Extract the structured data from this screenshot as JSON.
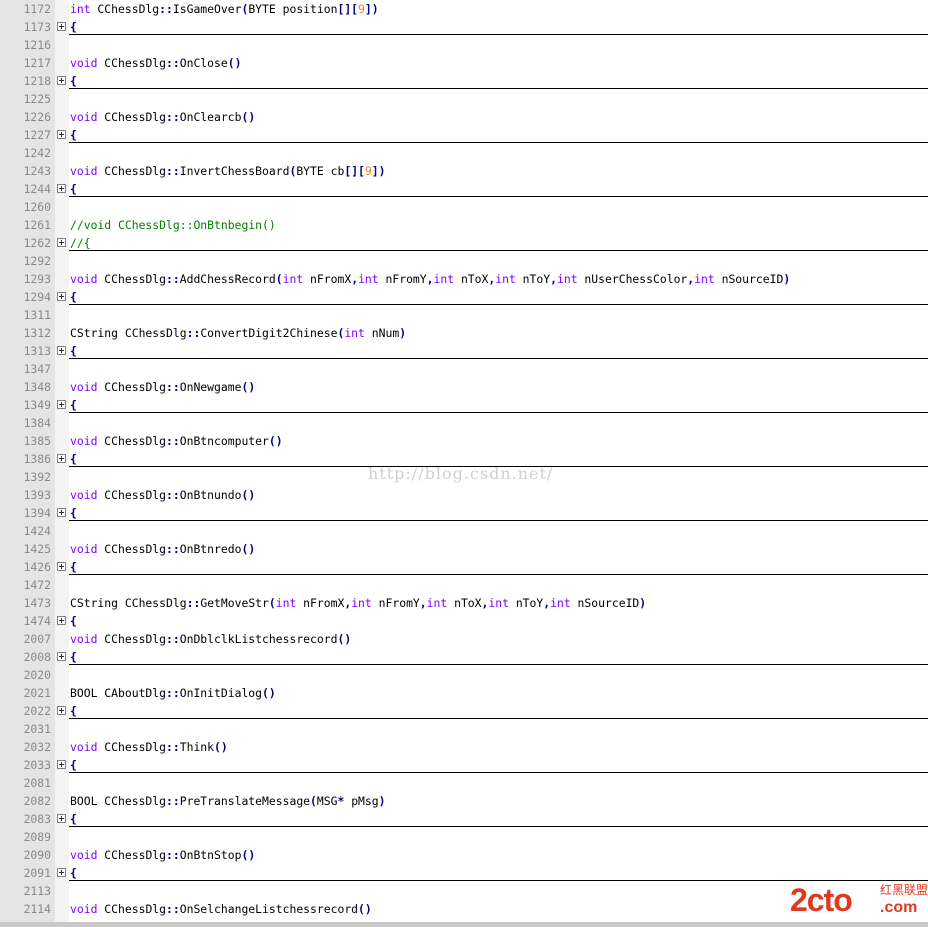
{
  "editor": {
    "rows": [
      {
        "ln": "1172",
        "code": [
          {
            "t": "int",
            "c": "kw"
          },
          {
            "t": " CChessDlg"
          },
          {
            "t": "::",
            "c": "op"
          },
          {
            "t": "IsGameOver"
          },
          {
            "t": "(",
            "c": "op"
          },
          {
            "t": "BYTE position"
          },
          {
            "t": "[][",
            "c": "op"
          },
          {
            "t": "9",
            "c": "num"
          },
          {
            "t": "])",
            "c": "op"
          }
        ]
      },
      {
        "ln": "1173",
        "fold": true,
        "line": true,
        "code": [
          {
            "t": "{",
            "c": "op"
          }
        ]
      },
      {
        "ln": "1216",
        "code": []
      },
      {
        "ln": "1217",
        "code": [
          {
            "t": "void",
            "c": "kw"
          },
          {
            "t": " CChessDlg"
          },
          {
            "t": "::",
            "c": "op"
          },
          {
            "t": "OnClose"
          },
          {
            "t": "()",
            "c": "op"
          }
        ]
      },
      {
        "ln": "1218",
        "fold": true,
        "line": true,
        "code": [
          {
            "t": "{",
            "c": "op"
          }
        ]
      },
      {
        "ln": "1225",
        "code": []
      },
      {
        "ln": "1226",
        "code": [
          {
            "t": "void",
            "c": "kw"
          },
          {
            "t": " CChessDlg"
          },
          {
            "t": "::",
            "c": "op"
          },
          {
            "t": "OnClearcb"
          },
          {
            "t": "()",
            "c": "op"
          }
        ]
      },
      {
        "ln": "1227",
        "fold": true,
        "line": true,
        "code": [
          {
            "t": "{",
            "c": "op"
          }
        ]
      },
      {
        "ln": "1242",
        "code": []
      },
      {
        "ln": "1243",
        "code": [
          {
            "t": "void",
            "c": "kw"
          },
          {
            "t": " CChessDlg"
          },
          {
            "t": "::",
            "c": "op"
          },
          {
            "t": "InvertChessBoard"
          },
          {
            "t": "(",
            "c": "op"
          },
          {
            "t": "BYTE cb"
          },
          {
            "t": "[][",
            "c": "op"
          },
          {
            "t": "9",
            "c": "num"
          },
          {
            "t": "])",
            "c": "op"
          }
        ]
      },
      {
        "ln": "1244",
        "fold": true,
        "line": true,
        "code": [
          {
            "t": "{",
            "c": "op"
          }
        ]
      },
      {
        "ln": "1260",
        "code": []
      },
      {
        "ln": "1261",
        "code": [
          {
            "t": "//void CChessDlg::OnBtnbegin()",
            "c": "cm"
          }
        ]
      },
      {
        "ln": "1262",
        "fold": true,
        "line": true,
        "code": [
          {
            "t": "//{",
            "c": "cm"
          }
        ]
      },
      {
        "ln": "1292",
        "code": []
      },
      {
        "ln": "1293",
        "code": [
          {
            "t": "void",
            "c": "kw"
          },
          {
            "t": " CChessDlg"
          },
          {
            "t": "::",
            "c": "op"
          },
          {
            "t": "AddChessRecord"
          },
          {
            "t": "(",
            "c": "op"
          },
          {
            "t": "int",
            "c": "kw"
          },
          {
            "t": " nFromX"
          },
          {
            "t": ",",
            "c": "op"
          },
          {
            "t": "int",
            "c": "kw"
          },
          {
            "t": " nFromY"
          },
          {
            "t": ",",
            "c": "op"
          },
          {
            "t": "int",
            "c": "kw"
          },
          {
            "t": " nToX"
          },
          {
            "t": ",",
            "c": "op"
          },
          {
            "t": "int",
            "c": "kw"
          },
          {
            "t": " nToY"
          },
          {
            "t": ",",
            "c": "op"
          },
          {
            "t": "int",
            "c": "kw"
          },
          {
            "t": " nUserChessColor"
          },
          {
            "t": ",",
            "c": "op"
          },
          {
            "t": "int",
            "c": "kw"
          },
          {
            "t": " nSourceID"
          },
          {
            "t": ")",
            "c": "op"
          }
        ]
      },
      {
        "ln": "1294",
        "fold": true,
        "line": true,
        "code": [
          {
            "t": "{",
            "c": "op"
          }
        ]
      },
      {
        "ln": "1311",
        "code": []
      },
      {
        "ln": "1312",
        "code": [
          {
            "t": "CString CChessDlg"
          },
          {
            "t": "::",
            "c": "op"
          },
          {
            "t": "ConvertDigit2Chinese"
          },
          {
            "t": "(",
            "c": "op"
          },
          {
            "t": "int",
            "c": "kw"
          },
          {
            "t": " nNum"
          },
          {
            "t": ")",
            "c": "op"
          }
        ]
      },
      {
        "ln": "1313",
        "fold": true,
        "line": true,
        "code": [
          {
            "t": "{",
            "c": "op"
          }
        ]
      },
      {
        "ln": "1347",
        "code": []
      },
      {
        "ln": "1348",
        "code": [
          {
            "t": "void",
            "c": "kw"
          },
          {
            "t": " CChessDlg"
          },
          {
            "t": "::",
            "c": "op"
          },
          {
            "t": "OnNewgame"
          },
          {
            "t": "()",
            "c": "op"
          }
        ]
      },
      {
        "ln": "1349",
        "fold": true,
        "line": true,
        "code": [
          {
            "t": "{",
            "c": "op"
          }
        ]
      },
      {
        "ln": "1384",
        "code": []
      },
      {
        "ln": "1385",
        "code": [
          {
            "t": "void",
            "c": "kw"
          },
          {
            "t": " CChessDlg"
          },
          {
            "t": "::",
            "c": "op"
          },
          {
            "t": "OnBtncomputer"
          },
          {
            "t": "()",
            "c": "op"
          }
        ]
      },
      {
        "ln": "1386",
        "fold": true,
        "line": true,
        "code": [
          {
            "t": "{",
            "c": "op"
          }
        ]
      },
      {
        "ln": "1392",
        "code": []
      },
      {
        "ln": "1393",
        "code": [
          {
            "t": "void",
            "c": "kw"
          },
          {
            "t": " CChessDlg"
          },
          {
            "t": "::",
            "c": "op"
          },
          {
            "t": "OnBtnundo"
          },
          {
            "t": "()",
            "c": "op"
          }
        ]
      },
      {
        "ln": "1394",
        "fold": true,
        "line": true,
        "code": [
          {
            "t": "{",
            "c": "op"
          }
        ]
      },
      {
        "ln": "1424",
        "code": []
      },
      {
        "ln": "1425",
        "code": [
          {
            "t": "void",
            "c": "kw"
          },
          {
            "t": " CChessDlg"
          },
          {
            "t": "::",
            "c": "op"
          },
          {
            "t": "OnBtnredo"
          },
          {
            "t": "()",
            "c": "op"
          }
        ]
      },
      {
        "ln": "1426",
        "fold": true,
        "line": true,
        "code": [
          {
            "t": "{",
            "c": "op"
          }
        ]
      },
      {
        "ln": "1472",
        "code": []
      },
      {
        "ln": "1473",
        "code": [
          {
            "t": "CString CChessDlg"
          },
          {
            "t": "::",
            "c": "op"
          },
          {
            "t": "GetMoveStr"
          },
          {
            "t": "(",
            "c": "op"
          },
          {
            "t": "int",
            "c": "kw"
          },
          {
            "t": " nFromX"
          },
          {
            "t": ",",
            "c": "op"
          },
          {
            "t": "int",
            "c": "kw"
          },
          {
            "t": " nFromY"
          },
          {
            "t": ",",
            "c": "op"
          },
          {
            "t": "int",
            "c": "kw"
          },
          {
            "t": " nToX"
          },
          {
            "t": ",",
            "c": "op"
          },
          {
            "t": "int",
            "c": "kw"
          },
          {
            "t": " nToY"
          },
          {
            "t": ",",
            "c": "op"
          },
          {
            "t": "int",
            "c": "kw"
          },
          {
            "t": " nSourceID"
          },
          {
            "t": ")",
            "c": "op"
          }
        ]
      },
      {
        "ln": "1474",
        "fold": true,
        "code": [
          {
            "t": "{",
            "c": "op"
          }
        ]
      },
      {
        "ln": "2007",
        "code": [
          {
            "t": "void",
            "c": "kw"
          },
          {
            "t": " CChessDlg"
          },
          {
            "t": "::",
            "c": "op"
          },
          {
            "t": "OnDblclkListchessrecord"
          },
          {
            "t": "()",
            "c": "op"
          }
        ]
      },
      {
        "ln": "2008",
        "fold": true,
        "line": true,
        "code": [
          {
            "t": "{",
            "c": "op"
          }
        ]
      },
      {
        "ln": "2020",
        "code": []
      },
      {
        "ln": "2021",
        "code": [
          {
            "t": "BOOL CAboutDlg"
          },
          {
            "t": "::",
            "c": "op"
          },
          {
            "t": "OnInitDialog"
          },
          {
            "t": "()",
            "c": "op"
          }
        ]
      },
      {
        "ln": "2022",
        "fold": true,
        "line": true,
        "code": [
          {
            "t": "{",
            "c": "op"
          }
        ]
      },
      {
        "ln": "2031",
        "code": []
      },
      {
        "ln": "2032",
        "code": [
          {
            "t": "void",
            "c": "kw"
          },
          {
            "t": " CChessDlg"
          },
          {
            "t": "::",
            "c": "op"
          },
          {
            "t": "Think"
          },
          {
            "t": "()",
            "c": "op"
          }
        ]
      },
      {
        "ln": "2033",
        "fold": true,
        "line": true,
        "code": [
          {
            "t": "{",
            "c": "op"
          }
        ]
      },
      {
        "ln": "2081",
        "code": []
      },
      {
        "ln": "2082",
        "code": [
          {
            "t": "BOOL CChessDlg"
          },
          {
            "t": "::",
            "c": "op"
          },
          {
            "t": "PreTranslateMessage"
          },
          {
            "t": "(",
            "c": "op"
          },
          {
            "t": "MSG"
          },
          {
            "t": "*",
            "c": "op"
          },
          {
            "t": " pMsg"
          },
          {
            "t": ")",
            "c": "op"
          }
        ]
      },
      {
        "ln": "2083",
        "fold": true,
        "line": true,
        "code": [
          {
            "t": "{",
            "c": "op"
          }
        ]
      },
      {
        "ln": "2089",
        "code": []
      },
      {
        "ln": "2090",
        "code": [
          {
            "t": "void",
            "c": "kw"
          },
          {
            "t": " CChessDlg"
          },
          {
            "t": "::",
            "c": "op"
          },
          {
            "t": "OnBtnStop"
          },
          {
            "t": "()",
            "c": "op"
          }
        ]
      },
      {
        "ln": "2091",
        "fold": true,
        "line": true,
        "code": [
          {
            "t": "{",
            "c": "op"
          }
        ]
      },
      {
        "ln": "2113",
        "code": []
      },
      {
        "ln": "2114",
        "code": [
          {
            "t": "void",
            "c": "kw"
          },
          {
            "t": " CChessDlg"
          },
          {
            "t": "::",
            "c": "op"
          },
          {
            "t": "OnSelchangeListchessrecord"
          },
          {
            "t": "()",
            "c": "op"
          }
        ]
      }
    ]
  },
  "watermark": {
    "text": "http://blog.csdn.net/"
  },
  "logo": {
    "main": "2cto",
    "cn": "红黑联盟",
    "domain": ".com"
  },
  "colors": {
    "keyword": "#8000ff",
    "operator": "#000080",
    "number": "#ff8000",
    "comment": "#008000",
    "line_number": "#8a8a8a",
    "gutter_bg": "#e4e4e4",
    "logo": "#e03a1e"
  },
  "icons": {
    "fold_marker": "plus-box-icon"
  }
}
